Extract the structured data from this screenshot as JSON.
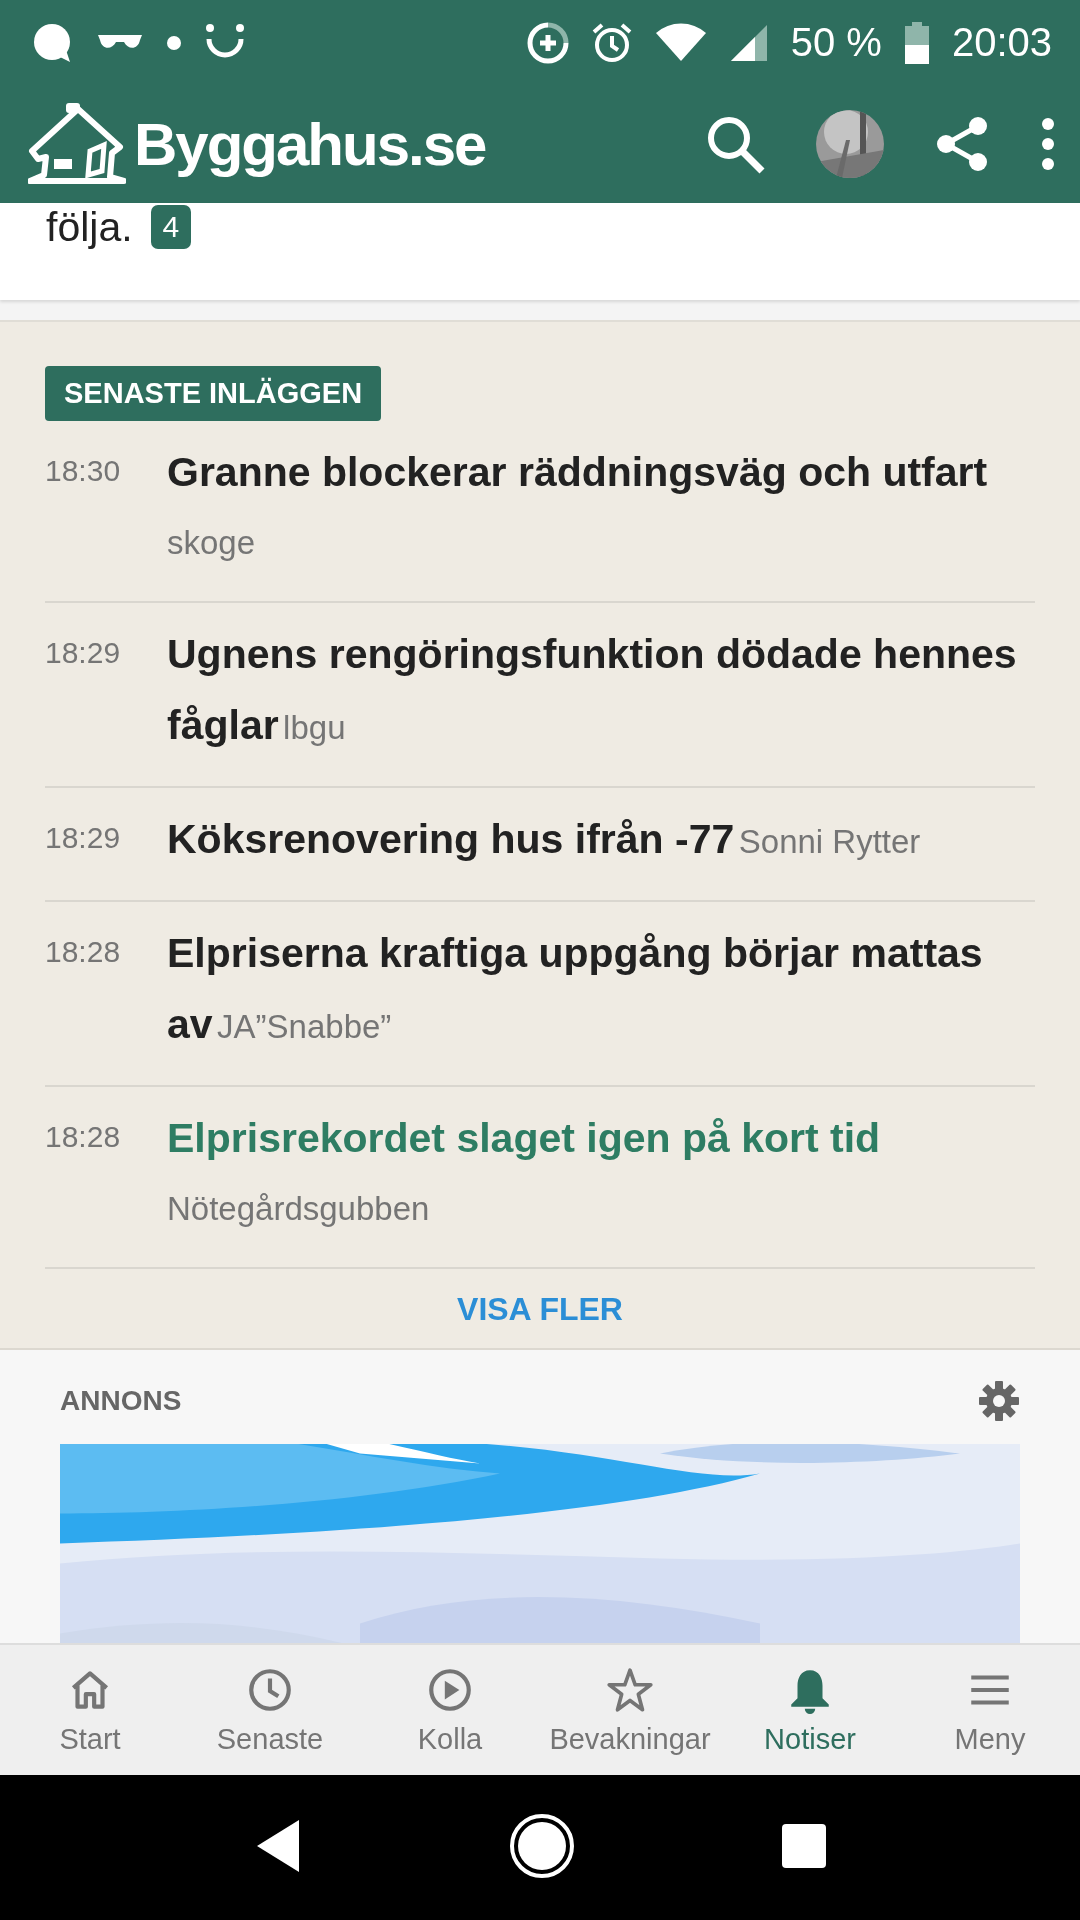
{
  "status_bar": {
    "battery": "50 %",
    "time": "20:03"
  },
  "header": {
    "logo": "Byggahus.se"
  },
  "snippet": {
    "text": "följa.",
    "count": "4"
  },
  "latest": {
    "heading": "SENASTE INLÄGGEN",
    "posts": [
      {
        "time": "18:30",
        "title": "Granne blockerar räddningsväg och utfart",
        "author": "skoge",
        "highlighted": false
      },
      {
        "time": "18:29",
        "title": "Ugnens rengöringsfunktion dödade hennes fåglar",
        "author": "lbgu",
        "highlighted": false
      },
      {
        "time": "18:29",
        "title": "Köksrenovering hus ifrån -77",
        "author": "Sonni Rytter",
        "highlighted": false
      },
      {
        "time": "18:28",
        "title": "Elpriserna kraftiga uppgång börjar mattas av",
        "author": "JA”Snabbe”",
        "highlighted": false
      },
      {
        "time": "18:28",
        "title": "Elprisrekordet slaget igen på kort tid",
        "author": "Nötegårdsgubben",
        "highlighted": true
      }
    ],
    "more": "VISA FLER"
  },
  "ad": {
    "label": "ANNONS"
  },
  "bottom_nav": [
    {
      "label": "Start",
      "selected": false
    },
    {
      "label": "Senaste",
      "selected": false
    },
    {
      "label": "Kolla",
      "selected": false
    },
    {
      "label": "Bevakningar",
      "selected": false
    },
    {
      "label": "Notiser",
      "selected": true
    },
    {
      "label": "Meny",
      "selected": false
    }
  ]
}
